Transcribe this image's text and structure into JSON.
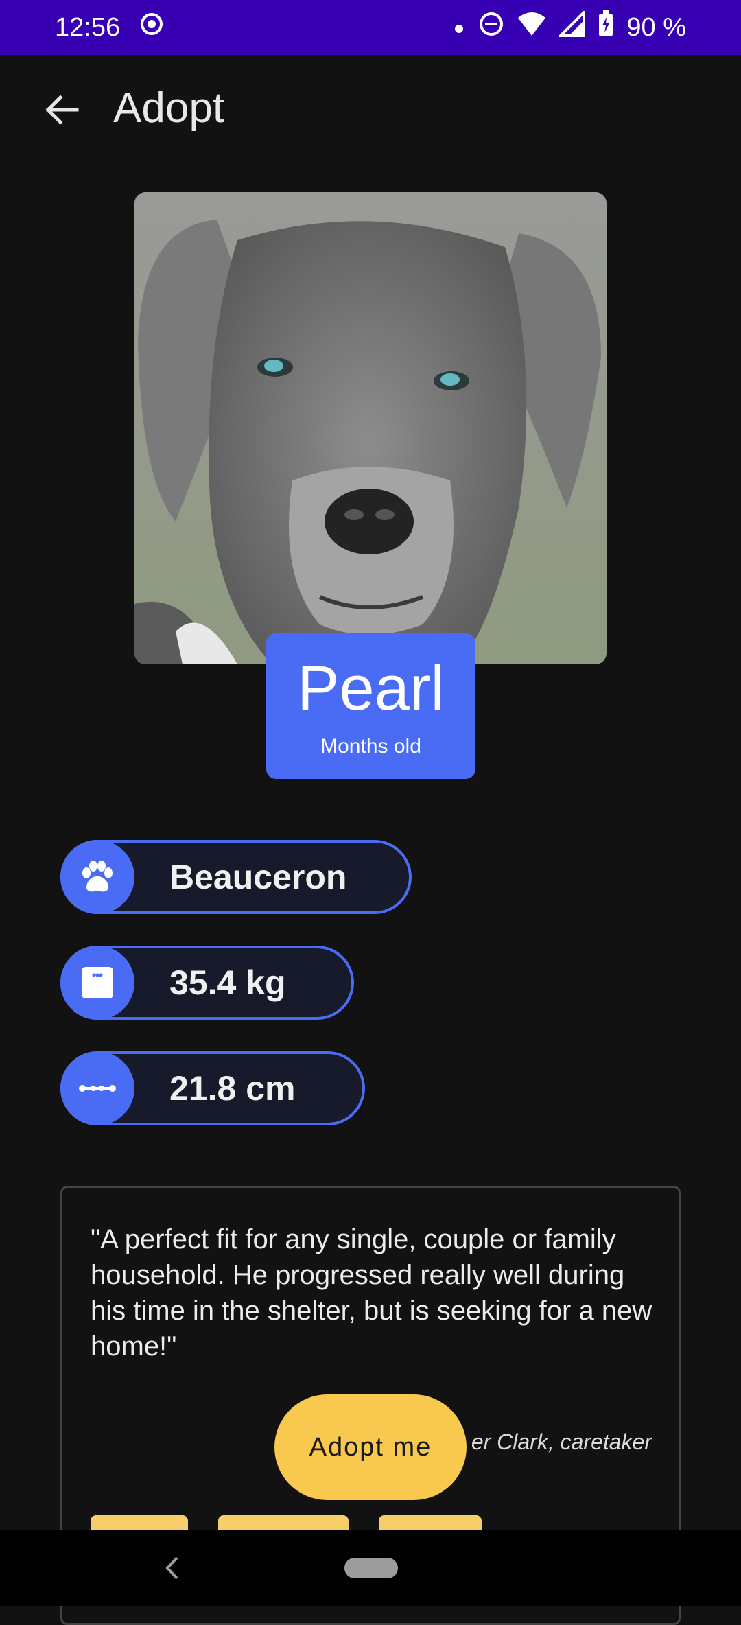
{
  "status_bar": {
    "time": "12:56",
    "battery": "90 %",
    "icons": [
      "location-sync-icon",
      "notification-dot-icon",
      "do-not-disturb-icon",
      "wifi-icon",
      "cell-signal-icon",
      "battery-charging-icon"
    ]
  },
  "app_bar": {
    "title": "Adopt",
    "back_icon": "arrow-back-icon"
  },
  "pet": {
    "name": "Pearl",
    "age": "Months old",
    "photo": "grey-dog-portrait",
    "details": [
      {
        "icon": "paw-icon",
        "label": "Beauceron"
      },
      {
        "icon": "weight-scale-icon",
        "label": "35.4 kg"
      },
      {
        "icon": "height-measure-icon",
        "label": "21.8 cm"
      }
    ]
  },
  "testimonial": {
    "quote": "\"A perfect fit for any single, couple or family household. He progressed really well during his time in the shelter, but is seeking for a new home!\"",
    "attribution_visible": "er Clark, caretaker"
  },
  "fab": {
    "label": "Adopt me"
  },
  "colors": {
    "accent": "#4a6cf5",
    "fab": "#f9c84f",
    "status_bar": "#3700b3",
    "background": "#121212"
  }
}
